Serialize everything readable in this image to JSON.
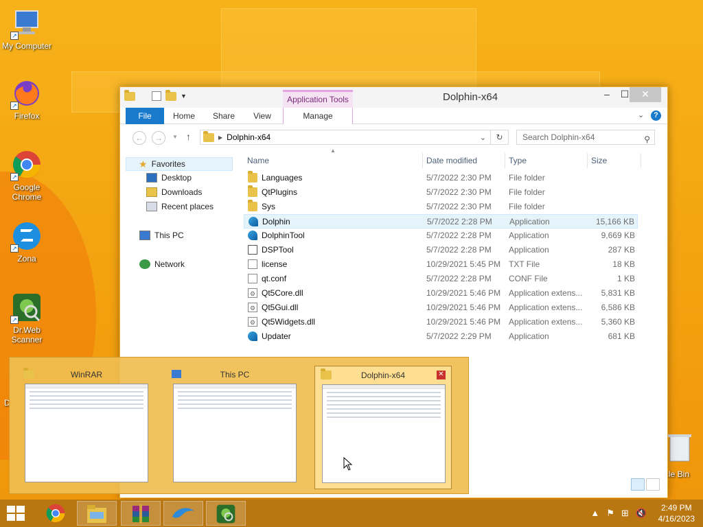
{
  "desktop": {
    "icons": [
      {
        "label": "My Computer",
        "icon": "computer-icon"
      },
      {
        "label": "Firefox",
        "icon": "firefox-icon"
      },
      {
        "label": "Google Chrome",
        "icon": "chrome-icon"
      },
      {
        "label": "Zona",
        "icon": "zona-icon"
      },
      {
        "label": "Dr.Web Scanner",
        "icon": "drweb-icon"
      }
    ],
    "partial_left_label": "D",
    "recycle_label": "cle Bin"
  },
  "explorer": {
    "title": "Dolphin-x64",
    "context_tab_header": "Application Tools",
    "tabs": {
      "file": "File",
      "home": "Home",
      "share": "Share",
      "view": "View",
      "manage": "Manage"
    },
    "address_path": "Dolphin-x64",
    "search_placeholder": "Search Dolphin-x64",
    "nav": {
      "favorites": "Favorites",
      "desktop": "Desktop",
      "downloads": "Downloads",
      "recent": "Recent places",
      "thispc": "This PC",
      "network": "Network"
    },
    "columns": {
      "name": "Name",
      "date": "Date modified",
      "type": "Type",
      "size": "Size"
    },
    "files": [
      {
        "name": "Languages",
        "date": "5/7/2022 2:30 PM",
        "type": "File folder",
        "size": "",
        "icon": "folder"
      },
      {
        "name": "QtPlugins",
        "date": "5/7/2022 2:30 PM",
        "type": "File folder",
        "size": "",
        "icon": "folder"
      },
      {
        "name": "Sys",
        "date": "5/7/2022 2:30 PM",
        "type": "File folder",
        "size": "",
        "icon": "folder"
      },
      {
        "name": "Dolphin",
        "date": "5/7/2022 2:28 PM",
        "type": "Application",
        "size": "15,166 KB",
        "icon": "app"
      },
      {
        "name": "DolphinTool",
        "date": "5/7/2022 2:28 PM",
        "type": "Application",
        "size": "9,669 KB",
        "icon": "app"
      },
      {
        "name": "DSPTool",
        "date": "5/7/2022 2:28 PM",
        "type": "Application",
        "size": "287 KB",
        "icon": "dsp"
      },
      {
        "name": "license",
        "date": "10/29/2021 5:45 PM",
        "type": "TXT File",
        "size": "18 KB",
        "icon": "doc"
      },
      {
        "name": "qt.conf",
        "date": "5/7/2022 2:28 PM",
        "type": "CONF File",
        "size": "1 KB",
        "icon": "doc"
      },
      {
        "name": "Qt5Core.dll",
        "date": "10/29/2021 5:46 PM",
        "type": "Application extens...",
        "size": "5,831 KB",
        "icon": "dll"
      },
      {
        "name": "Qt5Gui.dll",
        "date": "10/29/2021 5:46 PM",
        "type": "Application extens...",
        "size": "6,586 KB",
        "icon": "dll"
      },
      {
        "name": "Qt5Widgets.dll",
        "date": "10/29/2021 5:46 PM",
        "type": "Application extens...",
        "size": "5,360 KB",
        "icon": "dll"
      },
      {
        "name": "Updater",
        "date": "5/7/2022 2:29 PM",
        "type": "Application",
        "size": "681 KB",
        "icon": "app"
      }
    ]
  },
  "switcher": {
    "windows": [
      {
        "title": "WinRAR"
      },
      {
        "title": "This PC"
      },
      {
        "title": "Dolphin-x64"
      }
    ]
  },
  "taskbar": {
    "time": "2:49 PM",
    "date": "4/16/2023"
  },
  "colors": {
    "accent": "#1979ca",
    "desktop": "#f4a511",
    "taskbar": "#b97712"
  }
}
